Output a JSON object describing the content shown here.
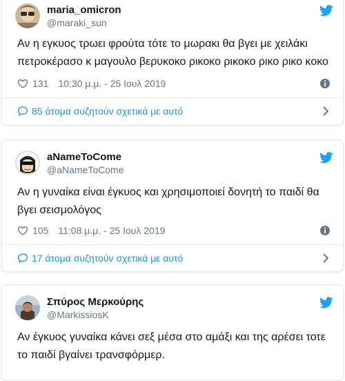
{
  "tweets": [
    {
      "name": "maria_omicron",
      "handle": "@maraki_sun",
      "text": "Αν η εγκυος τρωει φρούτα τότε το μωρακι θα βγει με χειλάκι πετροκέρασο κ μαγουλο βερυκοκο ρικοκο ρικοκο ρικο ρικο κοκο",
      "likes": "131",
      "timestamp": "10:30 μ.μ. - 25 Ιουλ 2019",
      "discussion": "85 άτομα συζητούν σχετικά με αυτό"
    },
    {
      "name": "aNameToCome",
      "handle": "@aNameToCome",
      "text": "Αν η γυναίκα είναι έγκυος και χρησιμοποιεί δονητή το παιδί θα βγει σεισμολόγος",
      "likes": "105",
      "timestamp": "11:08 μ.μ. - 25 Ιουλ 2019",
      "discussion": "17 άτομα συζητούν σχετικά με αυτό"
    },
    {
      "name": "Σπύρος Μερκούρης",
      "handle": "@MarkissiosK",
      "text": "Αν έγκυος γυναίκα κάνει σεξ μέσα στο αμάξι και της αρέσει τοτε το παιδί βγαίνει τρανσφόρμερ."
    }
  ],
  "icons": {
    "brand": "twitter-bird-icon",
    "like": "heart-icon",
    "info": "info-icon",
    "discuss": "speech-bubble-icon",
    "more": "chevron-right-icon"
  },
  "colors": {
    "brand": "#1da1f2",
    "link": "#1b95e0",
    "muted": "#657786",
    "text": "#14171a",
    "border": "#e1e8ed"
  }
}
